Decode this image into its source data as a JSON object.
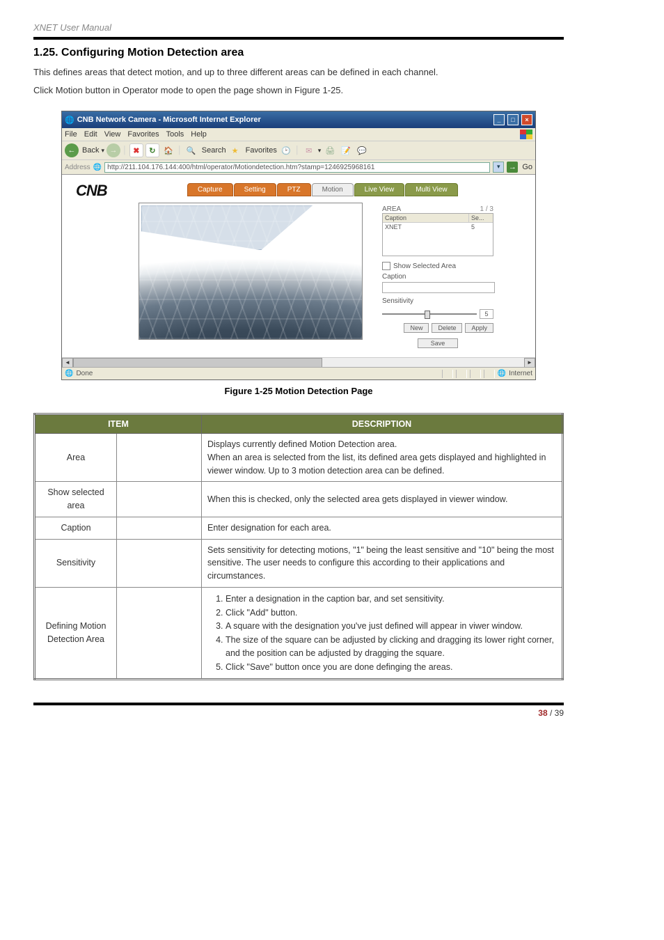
{
  "doc": {
    "header": "XNET User Manual",
    "section_title": "1.25. Configuring Motion Detection area",
    "intro_line1": "This defines areas that detect motion, and up to three different areas can be defined in each channel.",
    "intro_line2": "Click Motion button in Operator mode to open the page shown in Figure 1-25.",
    "figure_caption": "Figure 1-25 Motion Detection Page",
    "page_current": "38",
    "page_sep": " / ",
    "page_total": "39"
  },
  "browser": {
    "window_title": "CNB Network Camera - Microsoft Internet Explorer",
    "menus": [
      "File",
      "Edit",
      "View",
      "Favorites",
      "Tools",
      "Help"
    ],
    "toolbar": {
      "back": "Back",
      "search": "Search",
      "favorites": "Favorites"
    },
    "address_label": "Address",
    "url": "http://211.104.176.144:400/html/operator/Motiondetection.htm?stamp=1246925968161",
    "go": "Go",
    "status_done": "Done",
    "status_zone": "Internet"
  },
  "app": {
    "logo": "CNB",
    "tabs": {
      "capture": "Capture",
      "setting": "Setting",
      "ptz": "PTZ",
      "motion": "Motion",
      "liveview": "Live View",
      "multiview": "Multi View"
    },
    "panel": {
      "title": "AREA",
      "index": "1 / 3",
      "header_caption": "Caption",
      "header_se": "Se...",
      "row_caption": "XNET",
      "row_se": "5",
      "show_selected": "Show Selected Area",
      "caption_label": "Caption",
      "sensitivity_label": "Sensitivity",
      "sensitivity_value": "5",
      "btn_new": "New",
      "btn_delete": "Delete",
      "btn_apply": "Apply",
      "btn_save": "Save"
    }
  },
  "table": {
    "head_item": "ITEM",
    "head_desc": "DESCRIPTION",
    "rows": {
      "area": {
        "item": "Area",
        "desc_l1": "Displays currently defined Motion Detection area.",
        "desc_l2": "When an area is selected from the list, its defined area gets displayed and highlighted in viewer window. Up to 3 motion detection area can be defined."
      },
      "show": {
        "item": "Show selected area",
        "desc": "When this is checked, only the selected area gets displayed in viewer window."
      },
      "caption": {
        "item": "Caption",
        "desc": "Enter designation for each area."
      },
      "sensitivity": {
        "item": "Sensitivity",
        "desc": "Sets sensitivity for detecting motions, \"1\" being the least sensitive and \"10\" being the most sensitive. The user needs to configure this according to their applications and circumstances."
      },
      "defining": {
        "item": "Defining Motion Detection Area",
        "s1": "Enter a designation in the caption bar, and set sensitivity.",
        "s2": "Click \"Add\" button.",
        "s3": "A square with the designation you've just defined will appear in viwer window.",
        "s4": "The size of the square can be adjusted by clicking and dragging its lower right corner, and the position can be adjusted by dragging the square.",
        "s5": "Click \"Save\" button once you are done definging the areas."
      }
    }
  }
}
